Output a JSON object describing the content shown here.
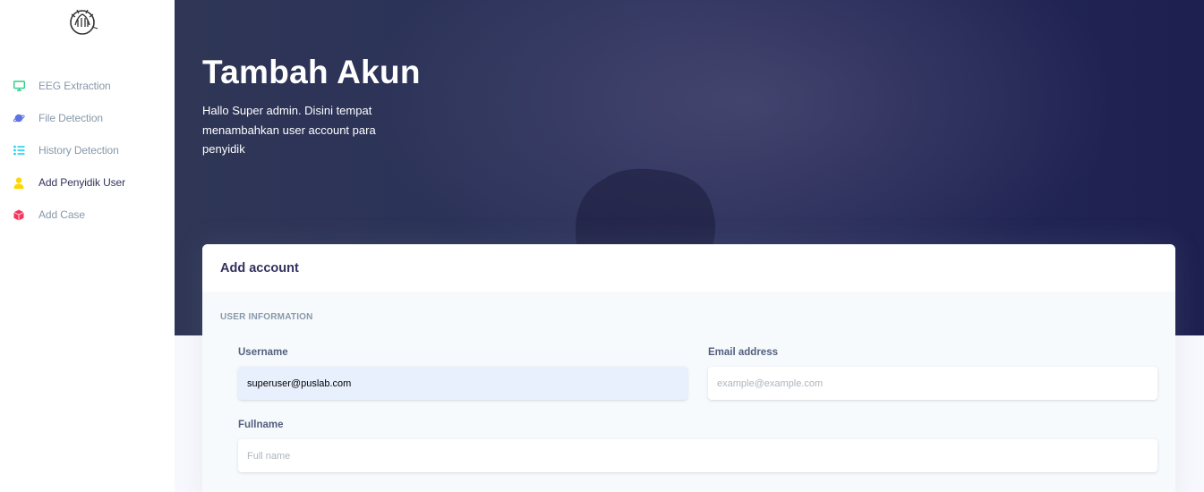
{
  "sidebar": {
    "logo": "logo",
    "items": [
      {
        "label": "EEG Extraction",
        "icon": "monitor-icon",
        "color": "#2dce89"
      },
      {
        "label": "File Detection",
        "icon": "planet-icon",
        "color": "#5e72e4"
      },
      {
        "label": "History Detection",
        "icon": "list-icon",
        "color": "#11cdef"
      },
      {
        "label": "Add Penyidik User",
        "icon": "user-icon",
        "color": "#ffd600"
      },
      {
        "label": "Add Case",
        "icon": "box-icon",
        "color": "#f5365c"
      }
    ]
  },
  "hero": {
    "title": "Tambah Akun",
    "description": "Hallo Super admin. Disini tempat menambahkan user account para penyidik"
  },
  "card": {
    "title": "Add account",
    "section": "USER INFORMATION",
    "fields": {
      "username": {
        "label": "Username",
        "value": "superuser@puslab.com",
        "placeholder": ""
      },
      "email": {
        "label": "Email address",
        "value": "",
        "placeholder": "example@example.com"
      },
      "fullname": {
        "label": "Fullname",
        "value": "",
        "placeholder": "Full name"
      }
    }
  }
}
